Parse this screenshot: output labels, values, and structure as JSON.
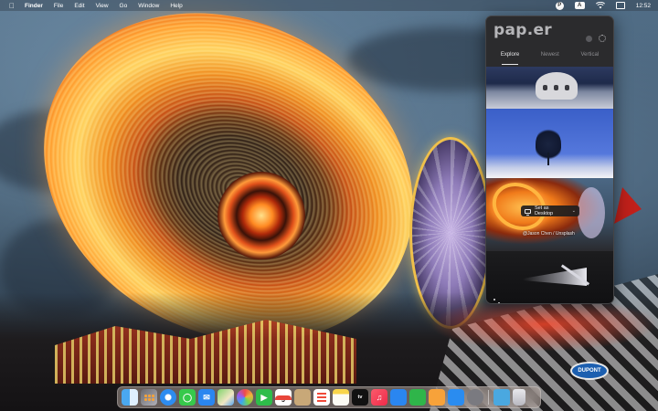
{
  "menubar": {
    "app_name": "Finder",
    "menus": [
      "File",
      "Edit",
      "View",
      "Go",
      "Window",
      "Help"
    ],
    "input_source": "A",
    "paper_status_glyph": "P",
    "time": "12:52"
  },
  "popover": {
    "logo": "pap.er",
    "tabs": [
      "Explore",
      "Newest",
      "Vertical"
    ],
    "active_tab": "Explore",
    "set_desktop_label": "Set as Desktop",
    "credit": "@Jason Chen / Unsplash"
  },
  "wallpaper": {
    "sign_text": "DUPONT"
  },
  "dock": {
    "calendar_day": "9",
    "tv_label": "tv",
    "apps": [
      "finder-icon",
      "launchpad-icon",
      "safari-icon",
      "messages-icon",
      "mail-icon",
      "maps-icon",
      "photos-icon",
      "facetime-icon",
      "calendar-icon",
      "contacts-icon",
      "reminders-icon",
      "notes-icon",
      "tv-icon",
      "music-icon",
      "keynote-icon",
      "numbers-icon",
      "pages-icon",
      "app-store-icon",
      "system-settings-icon",
      "downloads-folder-icon",
      "trash-icon"
    ]
  }
}
